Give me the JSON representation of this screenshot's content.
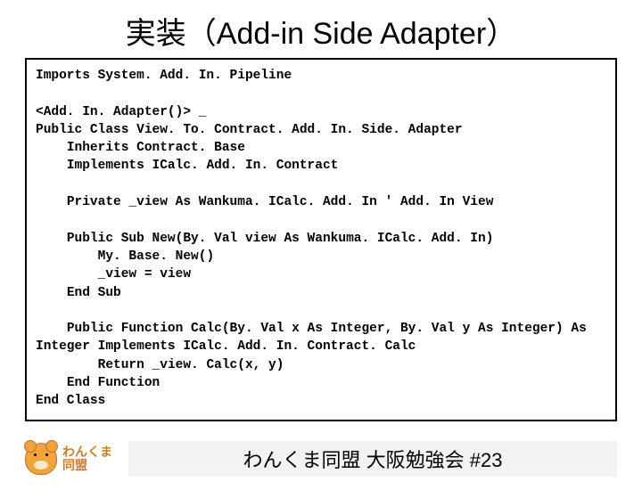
{
  "title": "実装（Add-in Side Adapter）",
  "code": "Imports System. Add. In. Pipeline\n\n<Add. In. Adapter()> _\nPublic Class View. To. Contract. Add. In. Side. Adapter\n    Inherits Contract. Base\n    Implements ICalc. Add. In. Contract\n\n    Private _view As Wankuma. ICalc. Add. In ' Add. In View\n\n    Public Sub New(By. Val view As Wankuma. ICalc. Add. In)\n        My. Base. New()\n        _view = view\n    End Sub\n\n    Public Function Calc(By. Val x As Integer, By. Val y As Integer) As Integer Implements ICalc. Add. In. Contract. Calc\n        Return _view. Calc(x, y)\n    End Function\nEnd Class",
  "logo": {
    "line1": "わんくま",
    "line2": "同盟"
  },
  "footer": "わんくま同盟 大阪勉強会 #23"
}
